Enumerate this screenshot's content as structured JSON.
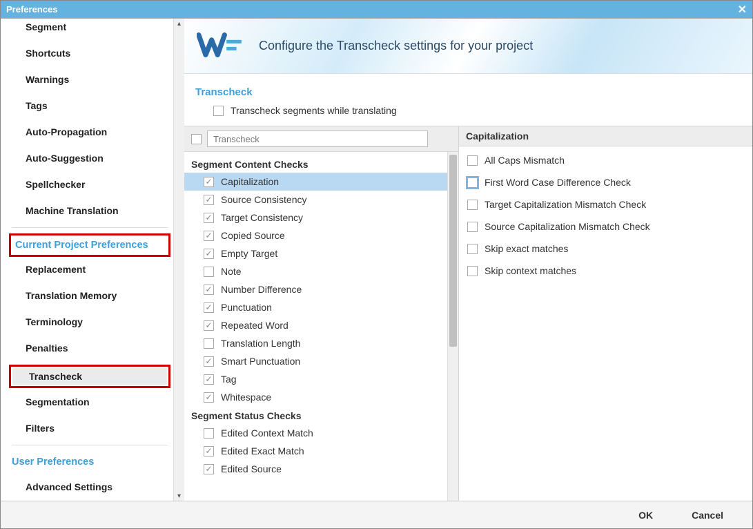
{
  "titlebar": {
    "title": "Preferences",
    "close": "✕"
  },
  "sidebar": {
    "general": {
      "items": [
        "Segment",
        "Shortcuts",
        "Warnings",
        "Tags",
        "Auto-Propagation",
        "Auto-Suggestion",
        "Spellchecker",
        "Machine Translation"
      ]
    },
    "project": {
      "title": "Current Project Preferences",
      "items": [
        "Replacement",
        "Translation Memory",
        "Terminology",
        "Penalties",
        "Transcheck",
        "Segmentation",
        "Filters"
      ]
    },
    "user": {
      "title": "User Preferences",
      "items": [
        "Advanced Settings"
      ]
    }
  },
  "banner": {
    "text": "Configure the Transcheck settings for your project"
  },
  "section": {
    "title": "Transcheck"
  },
  "topcheck": {
    "label": "Transcheck segments while translating",
    "checked": false
  },
  "left": {
    "header_cb_checked": false,
    "search_value": "Transcheck",
    "groups": [
      {
        "title": "Segment Content Checks",
        "items": [
          {
            "label": "Capitalization",
            "checked": true,
            "selected": true
          },
          {
            "label": "Source Consistency",
            "checked": true
          },
          {
            "label": "Target Consistency",
            "checked": true
          },
          {
            "label": "Copied Source",
            "checked": true
          },
          {
            "label": "Empty Target",
            "checked": true
          },
          {
            "label": "Note",
            "checked": false
          },
          {
            "label": "Number Difference",
            "checked": true
          },
          {
            "label": "Punctuation",
            "checked": true
          },
          {
            "label": "Repeated Word",
            "checked": true
          },
          {
            "label": "Translation Length",
            "checked": false
          },
          {
            "label": "Smart Punctuation",
            "checked": true
          },
          {
            "label": "Tag",
            "checked": true
          },
          {
            "label": "Whitespace",
            "checked": true
          }
        ]
      },
      {
        "title": "Segment Status Checks",
        "items": [
          {
            "label": "Edited Context Match",
            "checked": false
          },
          {
            "label": "Edited Exact Match",
            "checked": true
          },
          {
            "label": "Edited Source",
            "checked": true
          }
        ]
      }
    ]
  },
  "right": {
    "title": "Capitalization",
    "items": [
      {
        "label": "All Caps Mismatch",
        "checked": false
      },
      {
        "label": "First Word Case Difference Check",
        "checked": false,
        "focus": true
      },
      {
        "label": "Target Capitalization Mismatch Check",
        "checked": false
      },
      {
        "label": "Source Capitalization Mismatch Check",
        "checked": false
      },
      {
        "label": "Skip exact matches",
        "checked": false
      },
      {
        "label": "Skip context matches",
        "checked": false
      }
    ]
  },
  "buttons": {
    "ok": "OK",
    "cancel": "Cancel"
  }
}
